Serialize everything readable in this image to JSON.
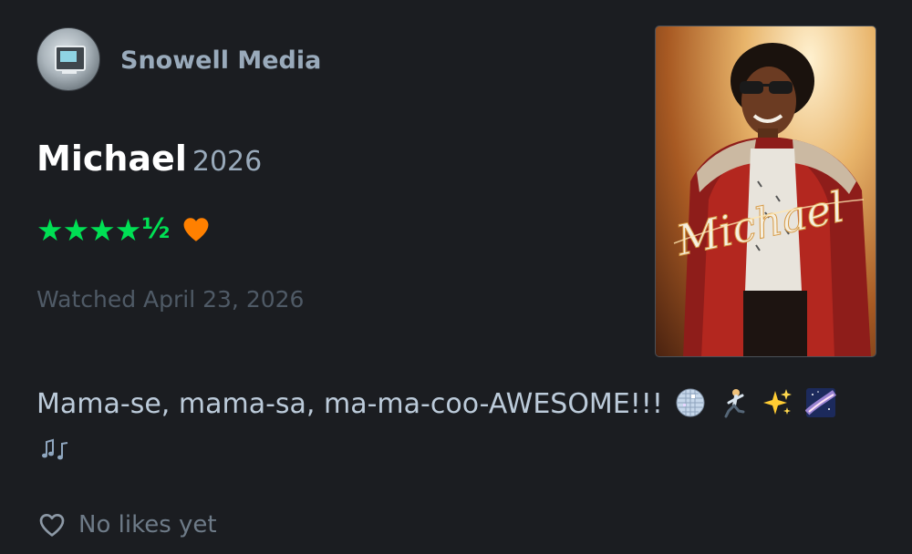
{
  "header": {
    "avatar_icon": "retro-computer-avatar",
    "username": "Snowell Media"
  },
  "film": {
    "title": "Michael",
    "year": "2026",
    "poster_title": "Michael"
  },
  "rating": {
    "stars": "★★★★",
    "half": "½",
    "stars_value": 4.5,
    "liked": true,
    "star_color": "#00e054",
    "like_color": "#ff8000"
  },
  "watched": {
    "text": "Watched April 23, 2026"
  },
  "review": {
    "text": "Mama-se, mama-sa, ma-ma-coo-AWESOME!!!",
    "emojis": [
      "mirror-ball-icon",
      "dancing-man-icon",
      "sparkles-icon",
      "milky-way-icon",
      "musical-notes-icon"
    ]
  },
  "likes": {
    "icon": "heart-outline-icon",
    "text": "No likes yet"
  }
}
